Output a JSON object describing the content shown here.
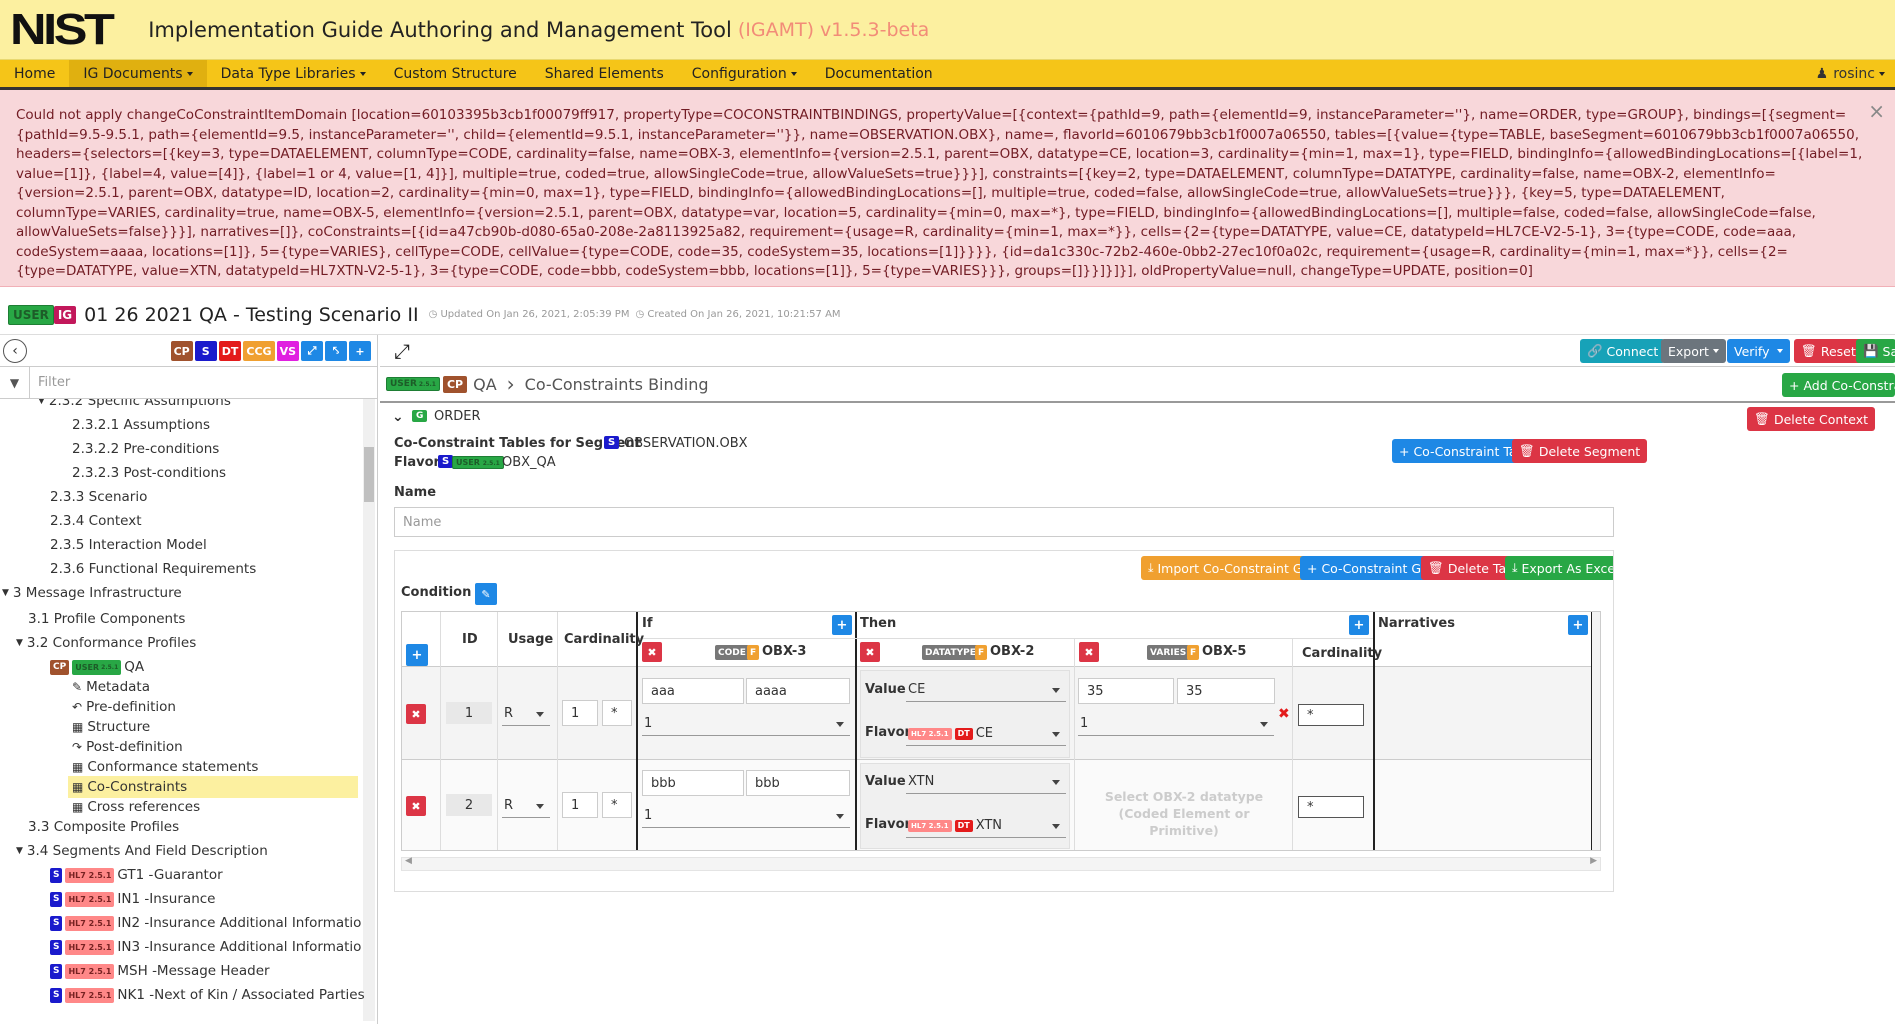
{
  "header": {
    "logo": "NIST",
    "title": "Implementation Guide Authoring and Management Tool",
    "version": "(IGAMT) v1.5.3-beta"
  },
  "nav": {
    "items": [
      {
        "label": "Home"
      },
      {
        "label": "IG Documents",
        "dropdown": true
      },
      {
        "label": "Data Type Libraries",
        "dropdown": true
      },
      {
        "label": "Custom Structure"
      },
      {
        "label": "Shared Elements"
      },
      {
        "label": "Configuration",
        "dropdown": true
      },
      {
        "label": "Documentation"
      }
    ],
    "user": "rosinc"
  },
  "error": {
    "message": "Could not apply changeCoConstraintItemDomain [location=60103395b3cb1f00079ff917, propertyType=COCONSTRAINTBINDINGS, propertyValue=[{context={pathId=9, path={elementId=9, instanceParameter=''}, name=ORDER, type=GROUP}, bindings=[{segment={pathId=9.5-9.5.1, path={elementId=9.5, instanceParameter='', child={elementId=9.5.1, instanceParameter=''}}, name=OBSERVATION.OBX}, name=, flavorId=6010679bb3cb1f0007a06550, tables=[{value={type=TABLE, baseSegment=6010679bb3cb1f0007a06550, headers={selectors=[{key=3, type=DATAELEMENT, columnType=CODE, cardinality=false, name=OBX-3, elementInfo={version=2.5.1, parent=OBX, datatype=CE, location=3, cardinality={min=1, max=1}, type=FIELD, bindingInfo={allowedBindingLocations=[{label=1, value=[1]}, {label=4, value=[4]}, {label=1 or 4, value=[1, 4]}], multiple=true, coded=true, allowSingleCode=true, allowValueSets=true}}}], constraints=[{key=2, type=DATAELEMENT, columnType=DATATYPE, cardinality=false, name=OBX-2, elementInfo={version=2.5.1, parent=OBX, datatype=ID, location=2, cardinality={min=0, max=1}, type=FIELD, bindingInfo={allowedBindingLocations=[], multiple=true, coded=false, allowSingleCode=true, allowValueSets=true}}}, {key=5, type=DATAELEMENT, columnType=VARIES, cardinality=true, name=OBX-5, elementInfo={version=2.5.1, parent=OBX, datatype=var, location=5, cardinality={min=0, max=*}, type=FIELD, bindingInfo={allowedBindingLocations=[], multiple=false, coded=false, allowSingleCode=false, allowValueSets=false}}}], narratives=[]}, coConstraints=[{id=a47cb90b-d080-65a0-208e-2a8113925a82, requirement={usage=R, cardinality={min=1, max=*}}, cells={2={type=DATATYPE, value=CE, datatypeId=HL7CE-V2-5-1}, 3={type=CODE, code=aaa, codeSystem=aaaa, locations=[1]}, 5={type=VARIES}, cellType=CODE, cellValue={type=CODE, code=35, codeSystem=35, locations=[1]}}}}, {id=da1c330c-72b2-460e-0bb2-27ec10f0a02c, requirement={usage=R, cardinality={min=1, max=*}}, cells={2={type=DATATYPE, value=XTN, datatypeId=HL7XTN-V2-5-1}, 3={type=CODE, code=bbb, codeSystem=bbb, locations=[1]}, 5={type=VARIES}}}, groups=[]}}]}]}], oldPropertyValue=null, changeType=UPDATE, position=0]"
  },
  "titlebar": {
    "badge_user": "USER",
    "badge_ig": "IG",
    "title": "01 26 2021 QA - Testing Scenario II",
    "updated": "Updated On Jan 26, 2021, 2:05:39 PM",
    "created": "Created On Jan 26, 2021, 10:21:57 AM"
  },
  "toolbar_badges": [
    "CP",
    "S",
    "DT",
    "CCG",
    "VS"
  ],
  "filter_placeholder": "Filter",
  "tree": [
    {
      "label": "2.3.2 Specific Assumptions",
      "indent": 2,
      "caret": true
    },
    {
      "label": "2.3.2.1 Assumptions",
      "indent": 3
    },
    {
      "label": "2.3.2.2 Pre-conditions",
      "indent": 3
    },
    {
      "label": "2.3.2.3 Post-conditions",
      "indent": 3
    },
    {
      "label": "2.3.3 Scenario",
      "indent": 2
    },
    {
      "label": "2.3.4 Context",
      "indent": 2
    },
    {
      "label": "2.3.5 Interaction Model",
      "indent": 2
    },
    {
      "label": "2.3.6 Functional Requirements",
      "indent": 2
    },
    {
      "label": "3 Message Infrastructure",
      "indent": 0,
      "caret": true
    },
    {
      "label": "3.1 Profile Components",
      "indent": 1
    },
    {
      "label": "3.2 Conformance Profiles",
      "indent": 1,
      "caret": true
    },
    {
      "label": "QA",
      "indent": 2,
      "badges": "cp"
    },
    {
      "label": "Metadata",
      "indent": 3,
      "icon": "✎"
    },
    {
      "label": "Pre-definition",
      "indent": 3,
      "icon": "↶"
    },
    {
      "label": "Structure",
      "indent": 3,
      "icon": "▦"
    },
    {
      "label": "Post-definition",
      "indent": 3,
      "icon": "↷"
    },
    {
      "label": "Conformance statements",
      "indent": 3,
      "icon": "▦"
    },
    {
      "label": "Co-Constraints",
      "indent": 3,
      "icon": "▦",
      "selected": true
    },
    {
      "label": "Cross references",
      "indent": 3,
      "icon": "▦"
    },
    {
      "label": "3.3 Composite Profiles",
      "indent": 1
    },
    {
      "label": "3.4 Segments And Field Description",
      "indent": 1,
      "caret": true
    },
    {
      "label": "GT1 -Guarantor",
      "indent": 2,
      "badges": "seg"
    },
    {
      "label": "IN1 -Insurance",
      "indent": 2,
      "badges": "seg"
    },
    {
      "label": "IN2 -Insurance Additional Informatio",
      "indent": 2,
      "badges": "seg"
    },
    {
      "label": "IN3 -Insurance Additional Informatio",
      "indent": 2,
      "badges": "seg"
    },
    {
      "label": "MSH -Message Header",
      "indent": 2,
      "badges": "seg"
    },
    {
      "label": "NK1 -Next of Kin / Associated Parties",
      "indent": 2,
      "badges": "seg"
    }
  ],
  "badges": {
    "cp": "CP",
    "s": "S",
    "user": "USER",
    "hl7": "HL7",
    "hl7ver": "2.5.1",
    "dt": "DT",
    "f": "F",
    "g": "G",
    "code": "CODE",
    "datatype": "DATATYPE",
    "varies": "VARIES"
  },
  "main_toolbar": {
    "connect": "Connect",
    "export": "Export",
    "verify": "Verify",
    "reset": "Reset",
    "save": "Sav"
  },
  "breadcrumb": {
    "profile": "QA",
    "page": "Co-Constraints Binding",
    "add_table": "Add Co-Constraint Table Bindin"
  },
  "context": {
    "name": "ORDER",
    "delete_context": "Delete Context",
    "tables_label": "Co-Constraint Tables for Segment",
    "segment": "OBSERVATION.OBX",
    "flavor_label": "Flavor",
    "flavor": "OBX_QA",
    "cc_table": "Co-Constraint Table",
    "delete_segment": "Delete Segment",
    "name_label": "Name",
    "name_placeholder": "Name"
  },
  "table_actions": {
    "import": "Import Co-Constraint Group",
    "group": "Co-Constraint Group",
    "delete": "Delete Table",
    "export": "Export As Excel",
    "condition": "Condition :"
  },
  "table": {
    "headers": {
      "id": "ID",
      "usage": "Usage",
      "cardinality": "Cardinality",
      "if": "If",
      "then": "Then",
      "narratives": "Narratives",
      "obx3": "OBX-3",
      "obx2": "OBX-2",
      "obx5": "OBX-5",
      "cardinality2": "Cardinality",
      "value": "Value",
      "flavor": "Flavor"
    },
    "rows": [
      {
        "id": "1",
        "usage": "R",
        "min": "1",
        "max": "*",
        "code": "aaa",
        "system": "aaaa",
        "loc": "1",
        "dt_value": "CE",
        "dt_flavor": "CE",
        "v_code": "35",
        "v_system": "35",
        "v_loc": "1",
        "card": "*"
      },
      {
        "id": "2",
        "usage": "R",
        "min": "1",
        "max": "*",
        "code": "bbb",
        "system": "bbb",
        "loc": "1",
        "dt_value": "XTN",
        "dt_flavor": "XTN",
        "v_hint": "Select OBX-2 datatype (Coded Element or Primitive)",
        "card": "*"
      }
    ]
  }
}
